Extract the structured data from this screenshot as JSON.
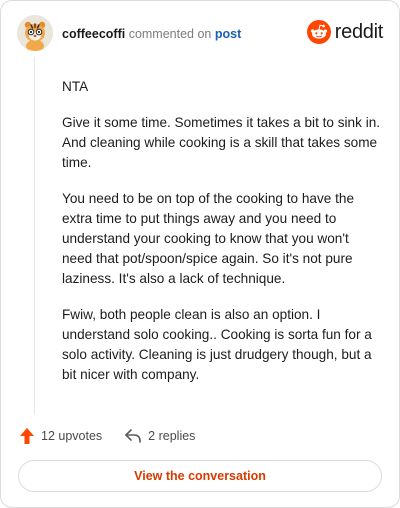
{
  "header": {
    "username": "coffeecoffi",
    "action_text": "commented on",
    "post_link": "post",
    "brand": "reddit"
  },
  "comment": {
    "paragraphs": [
      "NTA",
      "Give it some time. Sometimes it takes a bit to sink in. And cleaning while cooking is a skill that takes some time.",
      "You need to be on top of the cooking to have the extra time to put things away and you need to understand your cooking to know that you won't need that pot/spoon/spice again. So it's not pure laziness. It's also a lack of technique.",
      "Fwiw, both people clean is also an option. I understand solo cooking.. Cooking is sorta fun for a solo activity. Cleaning is just drudgery though, but a bit nicer with company."
    ]
  },
  "actions": {
    "upvotes": "12 upvotes",
    "replies": "2 replies"
  },
  "footer": {
    "view_conversation": "View the conversation"
  },
  "colors": {
    "brand_orange": "#ff4500",
    "link_blue": "#1a5fb4",
    "cta_text": "#d93a00"
  },
  "icons": {
    "avatar": "tiger-avatar-icon",
    "logo": "reddit-snoo-icon",
    "upvote": "upvote-arrow-icon",
    "reply": "reply-arrow-icon"
  }
}
